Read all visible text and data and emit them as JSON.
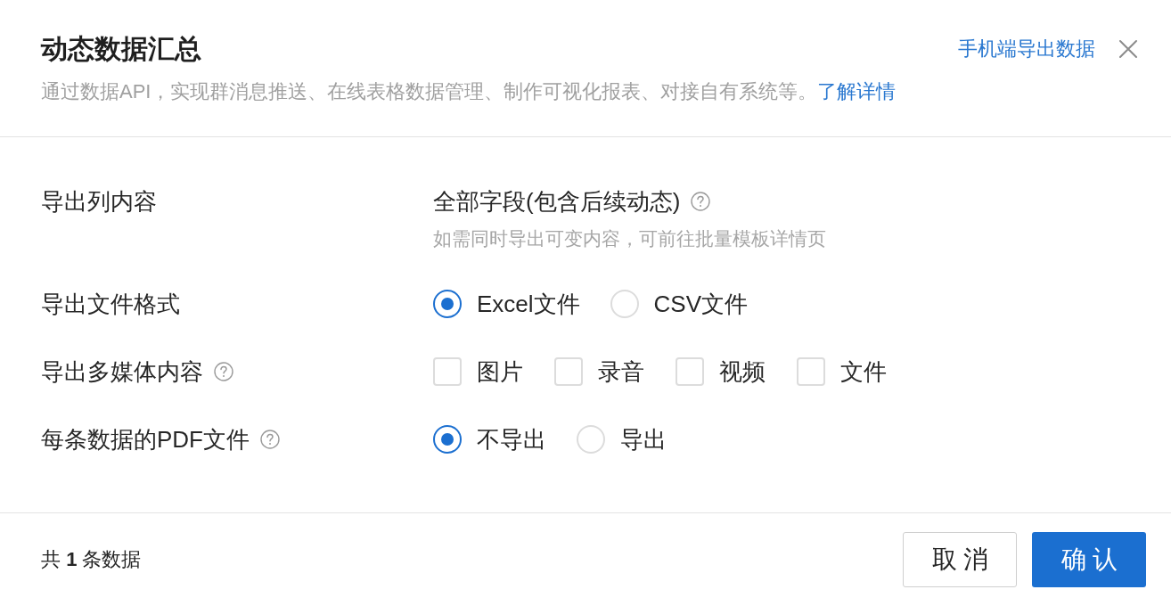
{
  "dialog": {
    "title": "动态数据汇总",
    "mobile_export_link": "手机端导出数据",
    "description": "通过数据API，实现群消息推送、在线表格数据管理、制作可视化报表、对接自有系统等。",
    "learn_more_link": "了解详情"
  },
  "fields": [
    {
      "kind": "text",
      "label": "导出列内容",
      "help": false,
      "value": "全部字段(包含后续动态)",
      "value_help": true,
      "hint": "如需同时导出可变内容，可前往批量模板详情页"
    },
    {
      "kind": "radio",
      "label": "导出文件格式",
      "help": false,
      "options": [
        {
          "label": "Excel文件",
          "selected": true
        },
        {
          "label": "CSV文件",
          "selected": false
        }
      ]
    },
    {
      "kind": "checkbox",
      "label": "导出多媒体内容",
      "help": true,
      "options": [
        {
          "label": "图片",
          "checked": false
        },
        {
          "label": "录音",
          "checked": false
        },
        {
          "label": "视频",
          "checked": false
        },
        {
          "label": "文件",
          "checked": false
        }
      ]
    },
    {
      "kind": "radio",
      "label": "每条数据的PDF文件",
      "help": true,
      "options": [
        {
          "label": "不导出",
          "selected": true
        },
        {
          "label": "导出",
          "selected": false
        }
      ]
    }
  ],
  "footer": {
    "record_count": "共 **1** 条数据"
  },
  "buttons": [
    {
      "kind": "secondary",
      "label": "取消"
    },
    {
      "kind": "primary",
      "label": "确认"
    }
  ]
}
